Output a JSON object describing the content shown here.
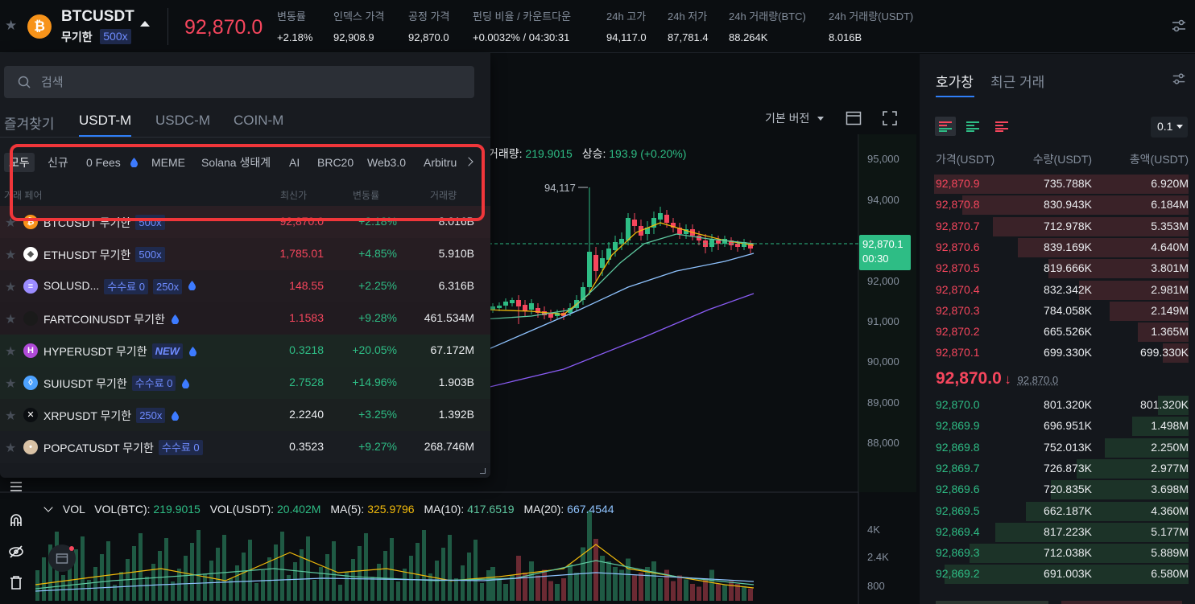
{
  "header": {
    "symbol": "BTCUSDT",
    "contract_type": "무기한",
    "leverage": "500x",
    "last_price": "92,870.0",
    "stats": [
      {
        "label": "변동률",
        "value": "+2.18%",
        "color": "green"
      },
      {
        "label": "인덱스 가격",
        "value": "92,908.9",
        "color": "white"
      },
      {
        "label": "공정 가격",
        "value": "92,870.0",
        "color": "white"
      },
      {
        "label": "펀딩 비율 / 카운트다운",
        "value": "+0.0032% / 04:30:31",
        "color": "white"
      },
      {
        "label": "24h 고가",
        "value": "94,117.0",
        "color": "white"
      },
      {
        "label": "24h 저가",
        "value": "87,781.4",
        "color": "white"
      },
      {
        "label": "24h 거래량(BTC)",
        "value": "88.264K",
        "color": "white"
      },
      {
        "label": "24h 거래량(USDT)",
        "value": "8.016B",
        "color": "white"
      }
    ]
  },
  "dropdown": {
    "search_placeholder": "검색",
    "tabs": [
      "즐겨찾기",
      "USDT-M",
      "USDC-M",
      "COIN-M"
    ],
    "active_tab": "USDT-M",
    "chips": [
      "모두",
      "신규",
      "0 Fees",
      "MEME",
      "Solana 생태계",
      "AI",
      "BRC20",
      "Web3.0",
      "Arbitru"
    ],
    "columns": [
      "거래 페어",
      "최신가",
      "변동률",
      "거래량"
    ],
    "rows": [
      {
        "symbol": "BTCUSDT 무기한",
        "badge": "500x",
        "price": "92,870.0",
        "change": "+2.18%",
        "volume": "8.016B",
        "price_color": "red",
        "icon": "bitcoin-icon",
        "icon_color": "#f7931a",
        "glyph": "₿"
      },
      {
        "symbol": "ETHUSDT 무기한",
        "badge": "500x",
        "price": "1,785.01",
        "change": "+4.85%",
        "volume": "5.910B",
        "price_color": "red",
        "icon": "ethereum-icon",
        "icon_color": "#ffffff",
        "glyph": "◆"
      },
      {
        "symbol": "SOLUSD...",
        "badge": "수수료 0",
        "badge2": "250x",
        "price": "148.55",
        "change": "+2.25%",
        "volume": "6.316B",
        "price_color": "red",
        "icon": "solana-icon",
        "icon_color": "#9b8cff",
        "glyph": "≡"
      },
      {
        "symbol": "FARTCOINUSDT 무기한",
        "badge": "",
        "price": "1.1583",
        "change": "+9.28%",
        "volume": "461.534M",
        "price_color": "red",
        "icon": "fartcoin-icon",
        "icon_color": "#1a1a1a",
        "glyph": ""
      },
      {
        "symbol": "HYPERUSDT 무기한",
        "badge": "NEW",
        "price": "0.3218",
        "change": "+20.05%",
        "volume": "67.172M",
        "price_color": "green",
        "icon": "hyper-icon",
        "icon_color": "#b04ad8",
        "glyph": "H"
      },
      {
        "symbol": "SUIUSDT 무기한",
        "badge": "수수료 0",
        "price": "2.7528",
        "change": "+14.96%",
        "volume": "1.903B",
        "price_color": "green",
        "icon": "sui-icon",
        "icon_color": "#4da2ff",
        "glyph": "◊"
      },
      {
        "symbol": "XRPUSDT 무기한",
        "badge": "250x",
        "price": "2.2240",
        "change": "+3.25%",
        "volume": "1.392B",
        "price_color": "white",
        "icon": "xrp-icon",
        "icon_color": "#0b0e11",
        "glyph": "✕"
      },
      {
        "symbol": "POPCATUSDT 무기한",
        "badge": "수수료 0",
        "price": "0.3523",
        "change": "+9.27%",
        "volume": "268.746M",
        "price_color": "white",
        "icon": "popcat-icon",
        "icon_color": "#d9c2a5",
        "glyph": "•"
      }
    ]
  },
  "chart": {
    "version_label": "기본 버전",
    "info_volume_label": "거래량:",
    "info_volume_value": "219.9015",
    "info_rise_label": "상승:",
    "info_rise_value": "193.9 (+0.20%)",
    "high_marker": "94,117",
    "price_tag": "92,870.1",
    "countdown": "00:30",
    "price_axis": [
      "95,000",
      "94,000",
      "92,000",
      "91,000",
      "90,000",
      "89,000",
      "88,000"
    ],
    "volume_axis": [
      "4K",
      "2.4K",
      "800"
    ],
    "vol_legend": {
      "title": "VOL",
      "vol_btc_label": "VOL(BTC):",
      "vol_btc": "219.9015",
      "vol_usdt_label": "VOL(USDT):",
      "vol_usdt": "20.402M",
      "ma5_label": "MA(5):",
      "ma5": "325.9796",
      "ma10_label": "MA(10):",
      "ma10": "417.6519",
      "ma20_label": "MA(20):",
      "ma20": "667.4544"
    }
  },
  "orderbook": {
    "tabs": [
      "호가창",
      "최근 거래"
    ],
    "precision": "0.1",
    "columns": [
      "가격(USDT)",
      "수량(USDT)",
      "총액(USDT)"
    ],
    "asks": [
      {
        "price": "92,870.9",
        "qty": "735.788K",
        "total": "6.920M",
        "depth": 1.0
      },
      {
        "price": "92,870.8",
        "qty": "830.943K",
        "total": "6.184M",
        "depth": 0.89
      },
      {
        "price": "92,870.7",
        "qty": "712.978K",
        "total": "5.353M",
        "depth": 0.77
      },
      {
        "price": "92,870.6",
        "qty": "839.169K",
        "total": "4.640M",
        "depth": 0.67
      },
      {
        "price": "92,870.5",
        "qty": "819.666K",
        "total": "3.801M",
        "depth": 0.55
      },
      {
        "price": "92,870.4",
        "qty": "832.342K",
        "total": "2.981M",
        "depth": 0.43
      },
      {
        "price": "92,870.3",
        "qty": "784.058K",
        "total": "2.149M",
        "depth": 0.31
      },
      {
        "price": "92,870.2",
        "qty": "665.526K",
        "total": "1.365M",
        "depth": 0.2
      },
      {
        "price": "92,870.1",
        "qty": "699.330K",
        "total": "699.330K",
        "depth": 0.1
      }
    ],
    "mid_price": "92,870.0",
    "mid_arrow": "↓",
    "mark_price": "92,870.0",
    "bids": [
      {
        "price": "92,870.0",
        "qty": "801.320K",
        "total": "801.320K",
        "depth": 0.12
      },
      {
        "price": "92,869.9",
        "qty": "696.951K",
        "total": "1.498M",
        "depth": 0.22
      },
      {
        "price": "92,869.8",
        "qty": "752.013K",
        "total": "2.250M",
        "depth": 0.33
      },
      {
        "price": "92,869.7",
        "qty": "726.873K",
        "total": "2.977M",
        "depth": 0.44
      },
      {
        "price": "92,869.6",
        "qty": "720.835K",
        "total": "3.698M",
        "depth": 0.54
      },
      {
        "price": "92,869.5",
        "qty": "662.187K",
        "total": "4.360M",
        "depth": 0.64
      },
      {
        "price": "92,869.4",
        "qty": "817.223K",
        "total": "5.177M",
        "depth": 0.76
      },
      {
        "price": "92,869.3",
        "qty": "712.038K",
        "total": "5.889M",
        "depth": 0.86
      },
      {
        "price": "92,869.2",
        "qty": "691.003K",
        "total": "6.580M",
        "depth": 0.96
      }
    ]
  },
  "colors": {
    "green": "#2ebd85",
    "red": "#f6465d",
    "accent": "#2f7ef7",
    "highlight": "#f0363a"
  }
}
